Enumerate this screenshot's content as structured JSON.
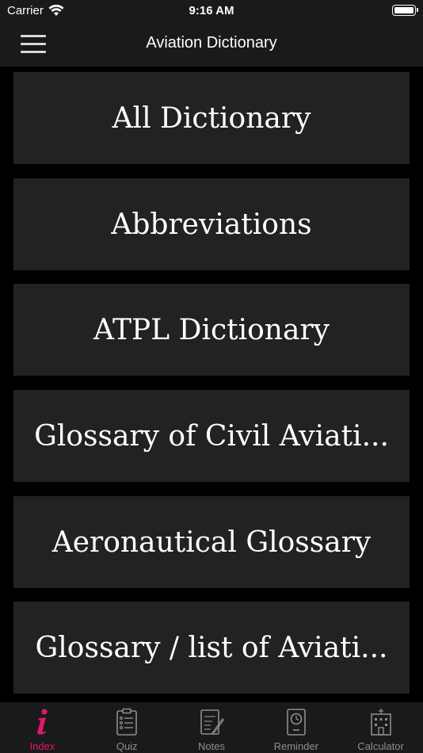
{
  "status_bar": {
    "carrier": "Carrier",
    "time": "9:16 AM"
  },
  "nav": {
    "title": "Aviation Dictionary",
    "menu_icon": "hamburger-menu-icon"
  },
  "list": {
    "items": [
      {
        "label": "All Dictionary"
      },
      {
        "label": "Abbreviations"
      },
      {
        "label": "ATPL Dictionary"
      },
      {
        "label": "Glossary of Civil Aviati..."
      },
      {
        "label": "Aeronautical Glossary"
      },
      {
        "label": "Glossary / list of Aviati..."
      }
    ]
  },
  "tab_bar": {
    "tabs": [
      {
        "label": "Index",
        "icon": "info-icon",
        "active": true
      },
      {
        "label": "Quiz",
        "icon": "clipboard-icon",
        "active": false
      },
      {
        "label": "Notes",
        "icon": "notes-icon",
        "active": false
      },
      {
        "label": "Reminder",
        "icon": "clock-icon",
        "active": false
      },
      {
        "label": "Calculator",
        "icon": "building-icon",
        "active": false
      }
    ]
  },
  "colors": {
    "background": "#000000",
    "bar": "#1a1a1a",
    "item": "#222222",
    "accent": "#e0176b",
    "inactive": "#8e8e8e"
  }
}
